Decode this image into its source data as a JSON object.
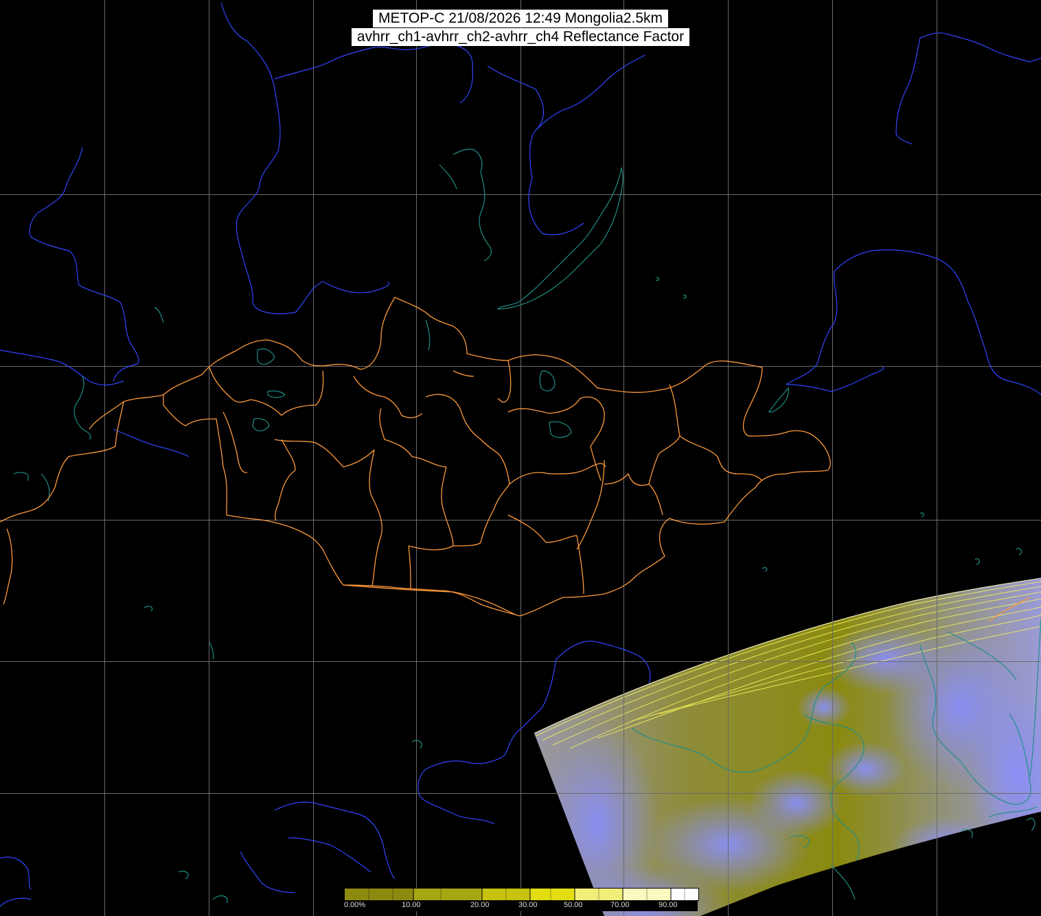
{
  "header": {
    "line1": "METOP-C 21/08/2026 12:49 Mongolia2.5km",
    "line2": "avhrr_ch1-avhrr_ch2-avhrr_ch4 Reflectance Factor"
  },
  "legend": {
    "labels": [
      "0.00%",
      "10.00",
      "20.00",
      "30.00",
      "50.00",
      "70.00",
      "90.00"
    ],
    "colors": [
      "#8e8a10",
      "#a8a512",
      "#c6c20e",
      "#e3de12",
      "#f2ee7a",
      "#fbf8c0",
      "#ffffff"
    ]
  },
  "colors": {
    "grid": "#6b6b6b",
    "country_border": "#ff9a3c",
    "river": "#3246ff",
    "coast": "#1f8f86",
    "swath_cloud": "#8a8ef8",
    "swath_land": "#8a8a10"
  }
}
